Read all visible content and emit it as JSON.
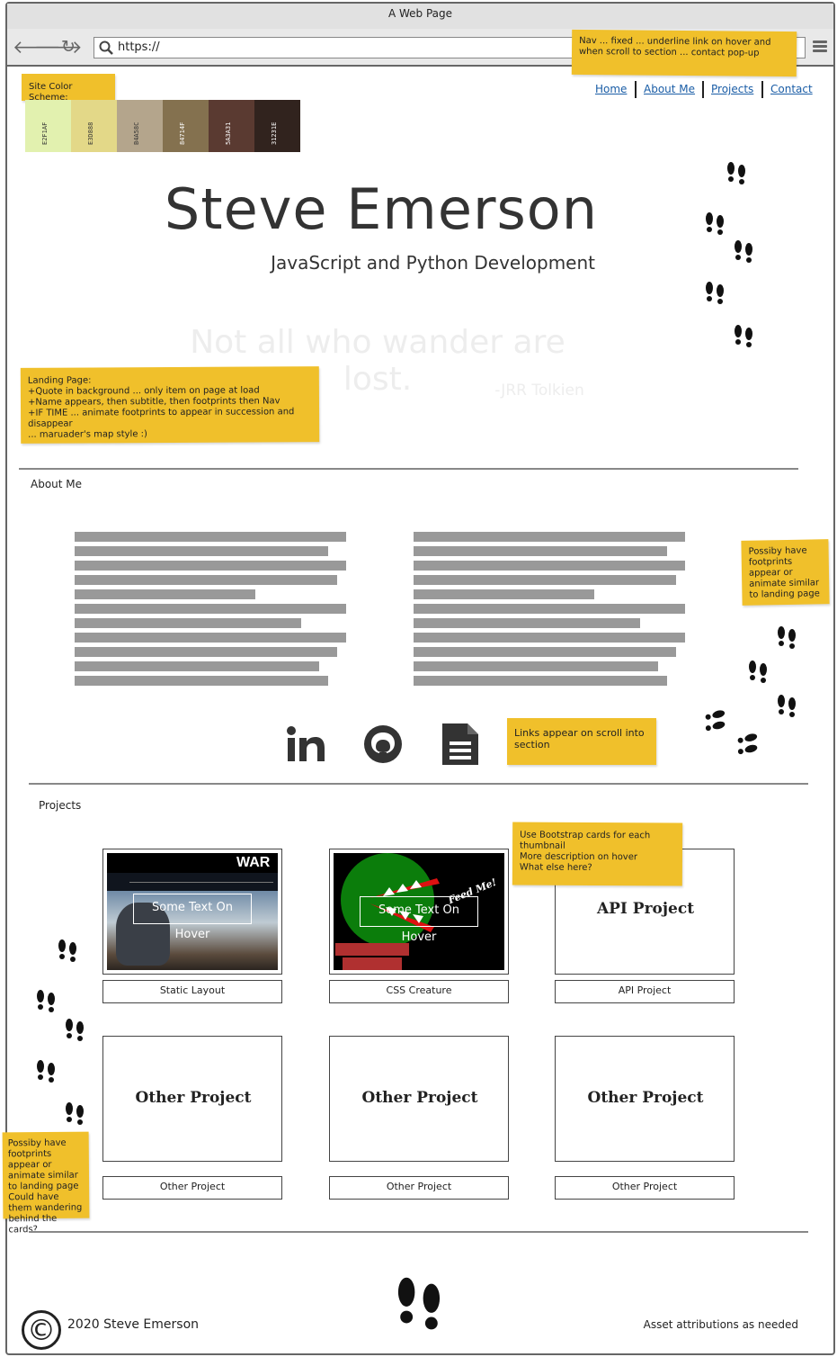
{
  "browser": {
    "title": "A Web Page",
    "url": "https://"
  },
  "notes": {
    "nav": "Nav ... fixed ... underline link on hover and when scroll to section ... contact pop-up",
    "color_scheme": "Site Color Scheme:",
    "landing_lines": [
      "Landing Page:",
      "+Quote in background ... only item on page at load",
      "+Name appears, then subtitle, then footprints then Nav",
      "+IF TIME ... animate footprints to appear in succession and disappear",
      "... maruader's map style :)"
    ],
    "about_footprints": "Possiby have footprints appear or animate similar to landing page",
    "links_scroll": "Links appear on scroll into section",
    "bootstrap_lines": [
      "Use Bootstrap cards for each thumbnail",
      "More description on hover",
      "What else here?"
    ],
    "projects_footprints": "Possiby have footprints appear or animate similar to landing page Could have them wandering behind the cards?"
  },
  "palette": [
    {
      "hex": "E2F1AF",
      "color": "#E2F1AF"
    },
    {
      "hex": "E3D888",
      "color": "#E3D888"
    },
    {
      "hex": "B4A58C",
      "color": "#B4A58C"
    },
    {
      "hex": "84714F",
      "color": "#84714F"
    },
    {
      "hex": "5A3A31",
      "color": "#5A3A31"
    },
    {
      "hex": "31231E",
      "color": "#31231E"
    }
  ],
  "nav": {
    "items": [
      "Home",
      "About Me",
      "Projects",
      "Contact"
    ]
  },
  "hero": {
    "name": "Steve Emerson",
    "subtitle": "JavaScript and Python Development",
    "quote": "Not all who wander are lost.",
    "quote_author": "-JRR Tolkien"
  },
  "about": {
    "title": "About Me",
    "social_icons": [
      "linkedin-icon",
      "github-icon",
      "document-icon"
    ]
  },
  "projects": {
    "title": "Projects",
    "cards": [
      {
        "label": "Static Layout",
        "hover": "Some Text On Hover"
      },
      {
        "label": "CSS Creature",
        "hover": "Some Text On Hover",
        "badge": "Feed Me!"
      },
      {
        "label": "API Project",
        "title": "API Project"
      },
      {
        "label": "Other Project",
        "title": "Other Project"
      },
      {
        "label": "Other Project",
        "title": "Other Project"
      },
      {
        "label": "Other Project",
        "title": "Other Project"
      }
    ]
  },
  "footer": {
    "copyright_symbol": "©",
    "copyright": "2020 Steve Emerson",
    "attribution": "Asset attributions as needed"
  }
}
